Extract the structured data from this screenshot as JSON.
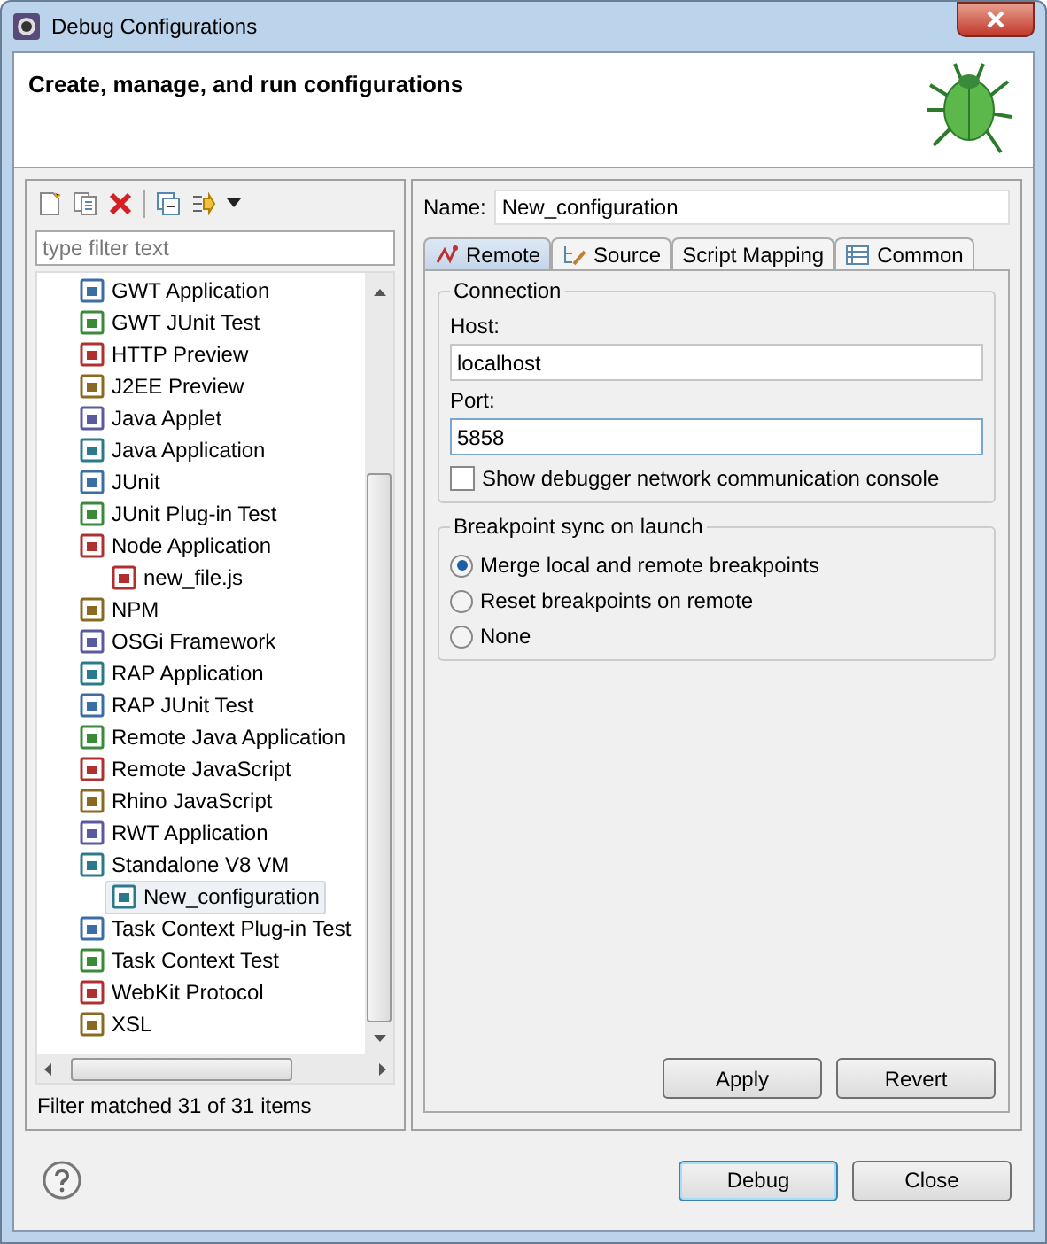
{
  "window": {
    "title": "Debug Configurations"
  },
  "header": {
    "title": "Create, manage, and run configurations"
  },
  "filter": {
    "placeholder": "type filter text"
  },
  "tree": [
    {
      "label": "GWT Application",
      "selected": false
    },
    {
      "label": "GWT JUnit Test",
      "selected": false
    },
    {
      "label": "HTTP Preview",
      "selected": false
    },
    {
      "label": "J2EE Preview",
      "selected": false
    },
    {
      "label": "Java Applet",
      "selected": false
    },
    {
      "label": "Java Application",
      "selected": false
    },
    {
      "label": "JUnit",
      "selected": false
    },
    {
      "label": "JUnit Plug-in Test",
      "selected": false
    },
    {
      "label": "Node Application",
      "selected": false,
      "children": [
        {
          "label": "new_file.js",
          "selected": false
        }
      ]
    },
    {
      "label": "NPM",
      "selected": false
    },
    {
      "label": "OSGi Framework",
      "selected": false
    },
    {
      "label": "RAP Application",
      "selected": false
    },
    {
      "label": "RAP JUnit Test",
      "selected": false
    },
    {
      "label": "Remote Java Application",
      "selected": false
    },
    {
      "label": "Remote JavaScript",
      "selected": false
    },
    {
      "label": "Rhino JavaScript",
      "selected": false
    },
    {
      "label": "RWT Application",
      "selected": false
    },
    {
      "label": "Standalone V8 VM",
      "selected": false,
      "children": [
        {
          "label": "New_configuration",
          "selected": true
        }
      ]
    },
    {
      "label": "Task Context Plug-in Test",
      "selected": false
    },
    {
      "label": "Task Context Test",
      "selected": false
    },
    {
      "label": "WebKit Protocol",
      "selected": false
    },
    {
      "label": "XSL",
      "selected": false
    }
  ],
  "filter_status": "Filter matched 31 of 31 items",
  "name_field": {
    "label": "Name:",
    "value": "New_configuration"
  },
  "tabs": [
    {
      "label": "Remote",
      "selected": true
    },
    {
      "label": "Source",
      "selected": false
    },
    {
      "label": "Script Mapping",
      "selected": false
    },
    {
      "label": "Common",
      "selected": false
    }
  ],
  "connection": {
    "title": "Connection",
    "host_label": "Host:",
    "host": "localhost",
    "port_label": "Port:",
    "port": "5858",
    "console_checkbox": {
      "label": "Show debugger network communication console",
      "checked": false
    }
  },
  "breakpoint_sync": {
    "title": "Breakpoint sync on launch",
    "options": [
      {
        "label": "Merge local and remote breakpoints",
        "selected": true
      },
      {
        "label": "Reset breakpoints on remote",
        "selected": false
      },
      {
        "label": "None",
        "selected": false
      }
    ]
  },
  "tab_buttons": [
    "Apply",
    "Revert"
  ],
  "dialog_buttons": [
    "Debug",
    "Close"
  ]
}
